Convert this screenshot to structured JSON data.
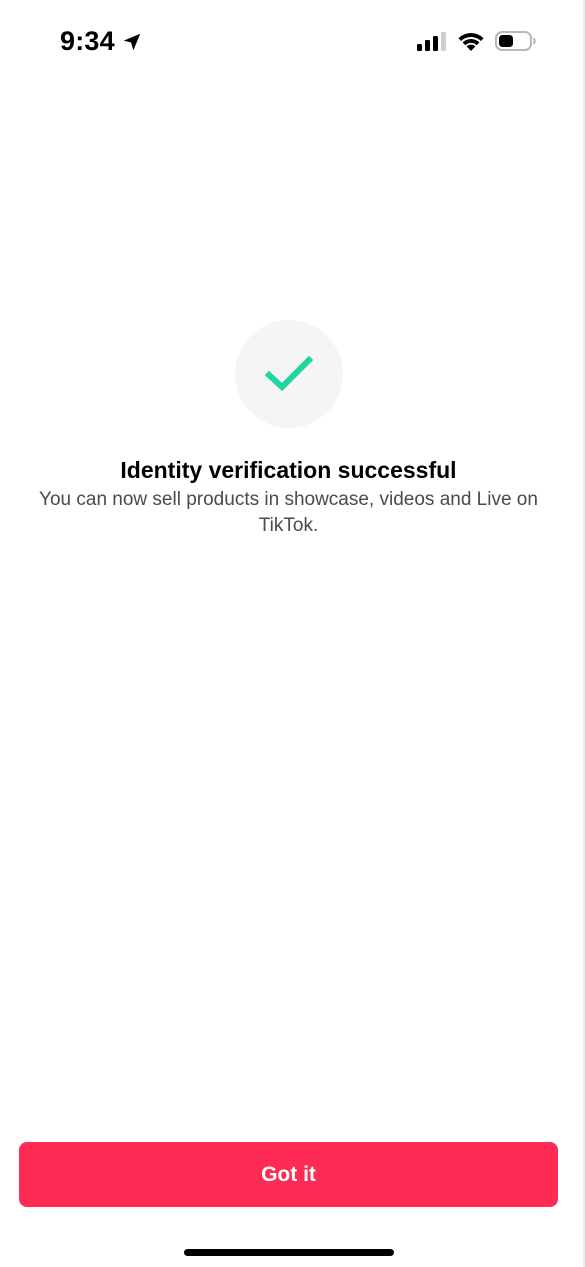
{
  "status_bar": {
    "time": "9:34",
    "location_icon": "location-arrow-icon",
    "signal_icon": "cellular-signal-icon",
    "wifi_icon": "wifi-icon",
    "battery_icon": "battery-icon"
  },
  "success": {
    "icon": "checkmark-icon",
    "title": "Identity verification successful",
    "message": "You can now sell products in showcase, videos and Live on TikTok."
  },
  "actions": {
    "primary_label": "Got it"
  },
  "colors": {
    "accent": "#fe2c55",
    "check": "#20d5a0",
    "circle_bg": "#f5f5f5"
  }
}
